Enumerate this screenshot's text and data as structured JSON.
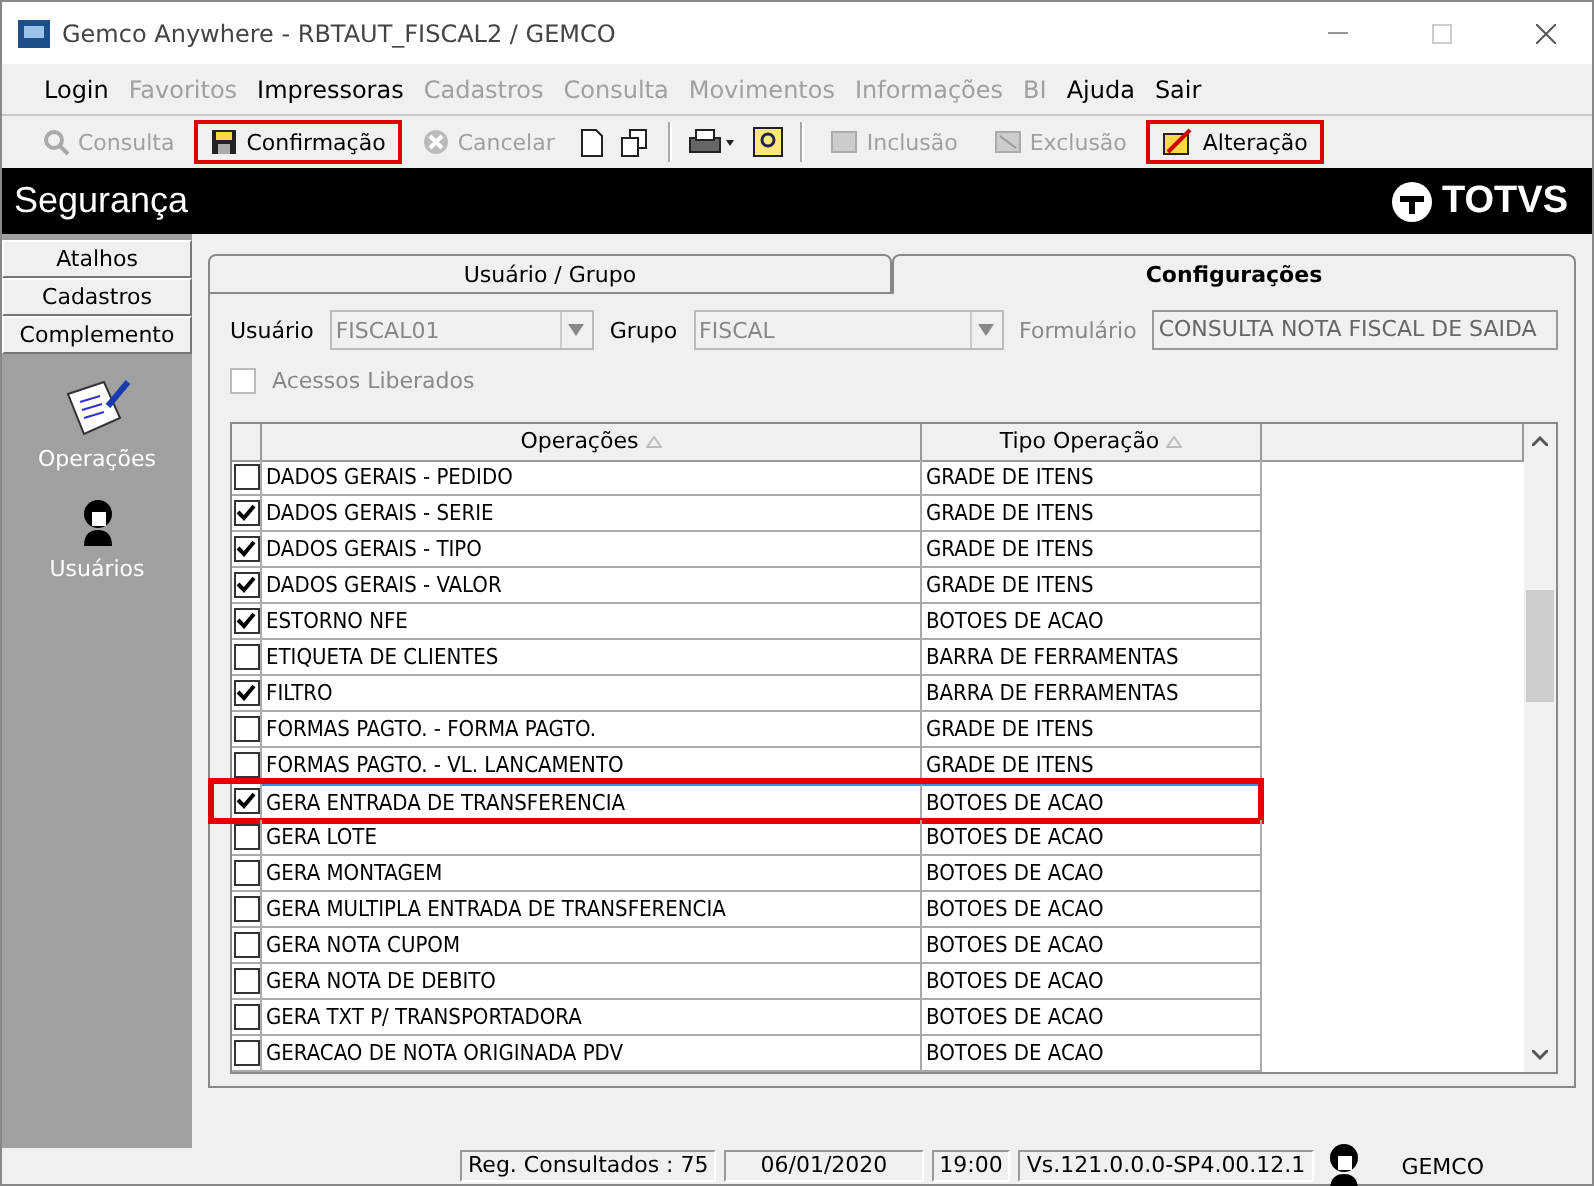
{
  "window": {
    "title": "Gemco Anywhere - RBTAUT_FISCAL2 / GEMCO"
  },
  "menu": [
    {
      "label": "Login",
      "disabled": false
    },
    {
      "label": "Favoritos",
      "disabled": true
    },
    {
      "label": "Impressoras",
      "disabled": false
    },
    {
      "label": "Cadastros",
      "disabled": true
    },
    {
      "label": "Consulta",
      "disabled": true
    },
    {
      "label": "Movimentos",
      "disabled": true
    },
    {
      "label": "Informações",
      "disabled": true
    },
    {
      "label": "BI",
      "disabled": true
    },
    {
      "label": "Ajuda",
      "disabled": false
    },
    {
      "label": "Sair",
      "disabled": false
    }
  ],
  "toolbar": [
    {
      "kind": "button",
      "label": "Consulta",
      "disabled": true,
      "highlighted": false
    },
    {
      "kind": "button",
      "label": "Confirmação",
      "disabled": false,
      "highlighted": true
    },
    {
      "kind": "button",
      "label": "Cancelar",
      "disabled": true,
      "highlighted": false
    },
    {
      "kind": "icon"
    },
    {
      "kind": "icon"
    },
    {
      "kind": "separator"
    },
    {
      "kind": "icon"
    },
    {
      "kind": "icon"
    },
    {
      "kind": "separator"
    },
    {
      "kind": "button",
      "label": "Inclusão",
      "disabled": true,
      "highlighted": false
    },
    {
      "kind": "button",
      "label": "Exclusão",
      "disabled": true,
      "highlighted": false
    },
    {
      "kind": "button",
      "label": "Alteração",
      "disabled": false,
      "highlighted": true
    }
  ],
  "header": {
    "title": "Segurança",
    "brand": "TOTVS"
  },
  "sidebar": {
    "sections": [
      {
        "label": "Atalhos"
      },
      {
        "label": "Cadastros"
      },
      {
        "label": "Complemento"
      }
    ],
    "items": [
      {
        "label": "Operações"
      },
      {
        "label": "Usuários"
      }
    ]
  },
  "tabs": [
    {
      "label": "Usuário  / Grupo",
      "selected": false
    },
    {
      "label": "Configurações",
      "selected": true
    }
  ],
  "form": {
    "usuario": {
      "label": "Usuário",
      "value": "FISCAL01"
    },
    "grupo": {
      "label": "Grupo",
      "value": "FISCAL"
    },
    "formulario": {
      "label": "Formulário",
      "value": "CONSULTA NOTA FISCAL DE SAIDA"
    },
    "acessos": {
      "label": "Acessos Liberados",
      "checked": false,
      "disabled": true
    }
  },
  "table": {
    "columns": [
      "Operações",
      "Tipo Operação"
    ],
    "rows": [
      {
        "operacao": "DADOS GERAIS - PEDIDO",
        "tipo": "GRADE DE ITENS",
        "checked": false,
        "selected": false,
        "highlighted": false
      },
      {
        "operacao": "DADOS GERAIS - SERIE",
        "tipo": "GRADE DE ITENS",
        "checked": true,
        "selected": false,
        "highlighted": false
      },
      {
        "operacao": "DADOS GERAIS - TIPO",
        "tipo": "GRADE DE ITENS",
        "checked": true,
        "selected": false,
        "highlighted": false
      },
      {
        "operacao": "DADOS GERAIS - VALOR",
        "tipo": "GRADE DE ITENS",
        "checked": true,
        "selected": false,
        "highlighted": false
      },
      {
        "operacao": "ESTORNO NFE",
        "tipo": "BOTOES DE ACAO",
        "checked": true,
        "selected": false,
        "highlighted": false
      },
      {
        "operacao": "ETIQUETA DE CLIENTES",
        "tipo": "BARRA DE FERRAMENTAS",
        "checked": false,
        "selected": false,
        "highlighted": false
      },
      {
        "operacao": "FILTRO",
        "tipo": "BARRA DE FERRAMENTAS",
        "checked": true,
        "selected": false,
        "highlighted": false
      },
      {
        "operacao": "FORMAS PAGTO. - FORMA PAGTO.",
        "tipo": "GRADE DE ITENS",
        "checked": false,
        "selected": false,
        "highlighted": false
      },
      {
        "operacao": "FORMAS PAGTO. - VL. LANCAMENTO",
        "tipo": "GRADE DE ITENS",
        "checked": false,
        "selected": false,
        "highlighted": false
      },
      {
        "operacao": "GERA ENTRADA DE TRANSFERENCIA",
        "tipo": "BOTOES DE ACAO",
        "checked": true,
        "selected": true,
        "highlighted": true
      },
      {
        "operacao": "GERA LOTE",
        "tipo": "BOTOES DE ACAO",
        "checked": false,
        "selected": false,
        "highlighted": false
      },
      {
        "operacao": "GERA MONTAGEM",
        "tipo": "BOTOES DE ACAO",
        "checked": false,
        "selected": false,
        "highlighted": false
      },
      {
        "operacao": "GERA MULTIPLA ENTRADA DE TRANSFERENCIA",
        "tipo": "BOTOES DE ACAO",
        "checked": false,
        "selected": false,
        "highlighted": false
      },
      {
        "operacao": "GERA NOTA CUPOM",
        "tipo": "BOTOES DE ACAO",
        "checked": false,
        "selected": false,
        "highlighted": false
      },
      {
        "operacao": "GERA NOTA DE DEBITO",
        "tipo": "BOTOES DE ACAO",
        "checked": false,
        "selected": false,
        "highlighted": false
      },
      {
        "operacao": "GERA TXT P/ TRANSPORTADORA",
        "tipo": "BOTOES DE ACAO",
        "checked": false,
        "selected": false,
        "highlighted": false
      },
      {
        "operacao": "GERACAO DE NOTA ORIGINADA PDV",
        "tipo": "BOTOES DE ACAO",
        "checked": false,
        "selected": false,
        "highlighted": false
      }
    ]
  },
  "status_bar": {
    "registros": "Reg. Consultados : 75",
    "date": "06/01/2020",
    "time": "19:00",
    "version": "Vs.121.0.0.0-SP4.00.12.1",
    "company": "GEMCO"
  }
}
